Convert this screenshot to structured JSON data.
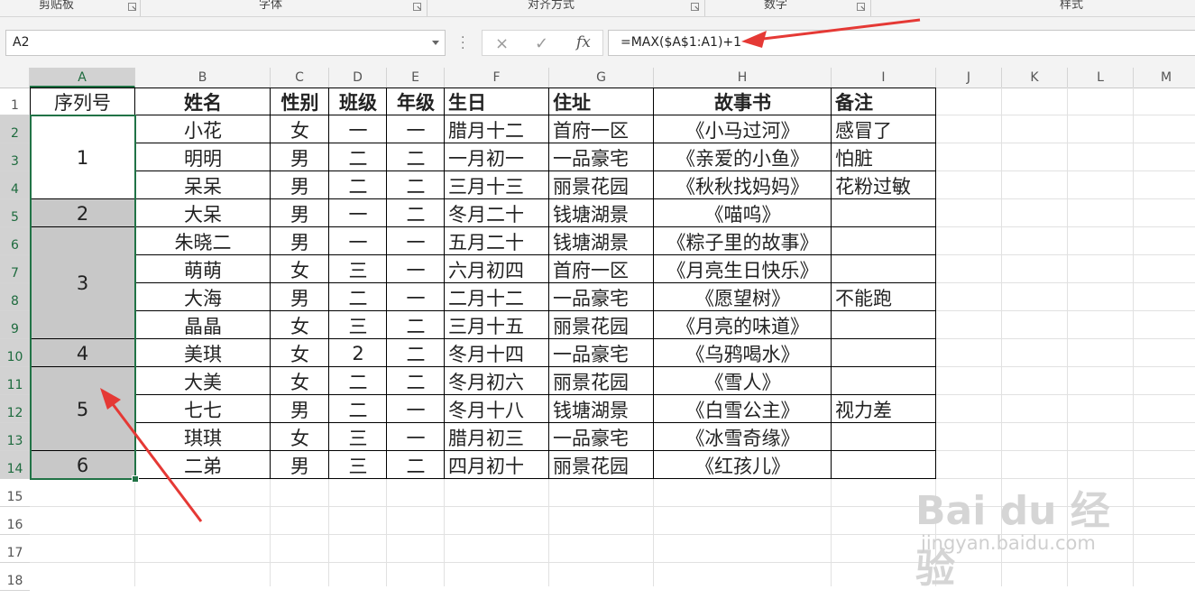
{
  "ribbon": {
    "groups": [
      "剪贴板",
      "字体",
      "对齐方式",
      "数字",
      "样式"
    ]
  },
  "formula_bar": {
    "name_box": "A2",
    "cancel_icon": "×",
    "enter_icon": "✓",
    "fx_label": "fx",
    "formula": "=MAX($A$1:A1)+1"
  },
  "columns": [
    "A",
    "B",
    "C",
    "D",
    "E",
    "F",
    "G",
    "H",
    "I",
    "J",
    "K",
    "L",
    "M"
  ],
  "rows": [
    "1",
    "2",
    "3",
    "4",
    "5",
    "6",
    "7",
    "8",
    "9",
    "10",
    "11",
    "12",
    "13",
    "14",
    "15",
    "16",
    "17",
    "18"
  ],
  "table": {
    "headers": [
      "序列号",
      "姓名",
      "性别",
      "班级",
      "年级",
      "生日",
      "住址",
      "故事书",
      "备注"
    ],
    "serials": [
      "1",
      "2",
      "3",
      "4",
      "5",
      "6"
    ],
    "rows": [
      [
        "小花",
        "女",
        "一",
        "一",
        "腊月十二",
        "首府一区",
        "《小马过河》",
        "感冒了"
      ],
      [
        "明明",
        "男",
        "二",
        "二",
        "一月初一",
        "一品豪宅",
        "《亲爱的小鱼》",
        "怕脏"
      ],
      [
        "呆呆",
        "男",
        "二",
        "二",
        "三月十三",
        "丽景花园",
        "《秋秋找妈妈》",
        "花粉过敏"
      ],
      [
        "大呆",
        "男",
        "一",
        "二",
        "冬月二十",
        "钱塘湖景",
        "《喵呜》",
        ""
      ],
      [
        "朱晓二",
        "男",
        "一",
        "一",
        "五月二十",
        "钱塘湖景",
        "《粽子里的故事》",
        ""
      ],
      [
        "萌萌",
        "女",
        "三",
        "一",
        "六月初四",
        "首府一区",
        "《月亮生日快乐》",
        ""
      ],
      [
        "大海",
        "男",
        "二",
        "一",
        "二月十二",
        "一品豪宅",
        "《愿望树》",
        "不能跑"
      ],
      [
        "晶晶",
        "女",
        "三",
        "二",
        "三月十五",
        "丽景花园",
        "《月亮的味道》",
        ""
      ],
      [
        "美琪",
        "女",
        "2",
        "二",
        "冬月十四",
        "一品豪宅",
        "《乌鸦喝水》",
        ""
      ],
      [
        "大美",
        "女",
        "二",
        "二",
        "冬月初六",
        "丽景花园",
        "《雪人》",
        ""
      ],
      [
        "七七",
        "男",
        "二",
        "一",
        "冬月十八",
        "钱塘湖景",
        "《白雪公主》",
        "视力差"
      ],
      [
        "琪琪",
        "女",
        "三",
        "一",
        "腊月初三",
        "一品豪宅",
        "《冰雪奇缘》",
        ""
      ],
      [
        "二弟",
        "男",
        "三",
        "二",
        "四月初十",
        "丽景花园",
        "《红孩儿》",
        ""
      ]
    ]
  },
  "watermark": {
    "brand": "Bai du 经验",
    "url": "jingyan.baidu.com"
  },
  "colors": {
    "selection": "#217346",
    "merged_fill": "#c8c8c8",
    "annotation_arrow": "#e53935"
  }
}
